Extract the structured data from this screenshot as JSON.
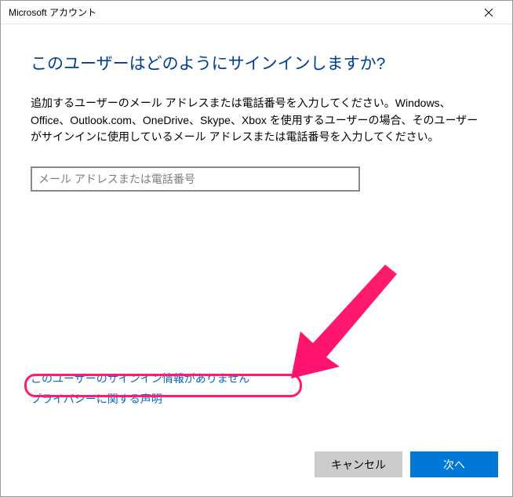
{
  "titlebar": {
    "title": "Microsoft アカウント"
  },
  "heading": "このユーザーはどのようにサインインしますか?",
  "description": "追加するユーザーのメール アドレスまたは電話番号を入力してください。Windows、Office、Outlook.com、OneDrive、Skype、Xbox を使用するユーザーの場合、そのユーザーがサインインに使用しているメール アドレスまたは電話番号を入力してください。",
  "input": {
    "placeholder": "メール アドレスまたは電話番号",
    "value": ""
  },
  "links": {
    "no_signin_info": "このユーザーのサインイン情報がありません",
    "privacy": "プライバシーに関する声明"
  },
  "buttons": {
    "cancel": "キャンセル",
    "next": "次へ"
  },
  "annotation": {
    "highlight_target": "no-signin-info-link",
    "arrow_color": "#ff1d6b"
  }
}
